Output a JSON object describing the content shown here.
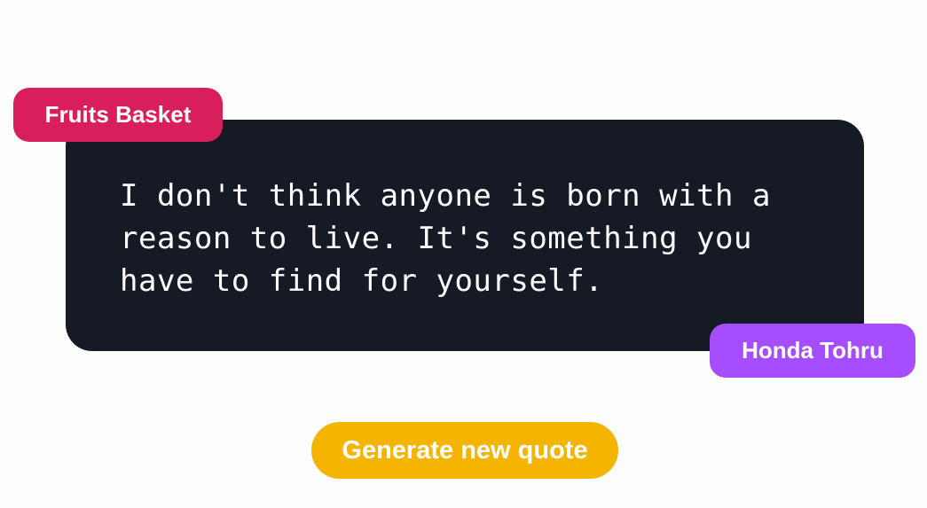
{
  "quote": {
    "text": "I don't think anyone is born with a reason to live. It's something you have to find for yourself.",
    "anime": "Fruits Basket",
    "character": "Honda Tohru"
  },
  "actions": {
    "generate_label": "Generate new quote"
  },
  "colors": {
    "background": "#fdfdfd",
    "card": "#151a24",
    "anime_badge": "#d81e5b",
    "character_badge": "#a64eff",
    "button": "#f4b400",
    "text": "#ffffff"
  }
}
